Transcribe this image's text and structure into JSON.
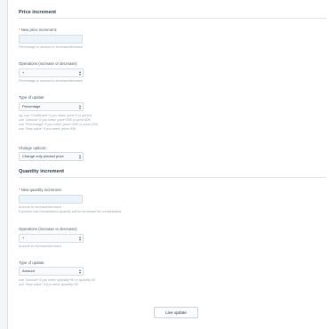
{
  "price_section": {
    "title": "Price increment",
    "new_price_label": "New price increment:",
    "new_price_value": "",
    "new_price_help": "Percentage or amount to increase/decrease",
    "operations_label": "Operations (increase or decrease):",
    "operations_value": "+",
    "operations_help": "Percentage or amount to increase/decrease",
    "type_label": "Type of update:",
    "type_value": "Percentage",
    "type_help": [
      "eg. use \"Coefficient\" if you need: price*2 or price/4",
      "use \"Amount\" if you need: price+50€ or price-50€",
      "use \"Percentage\" if you need: price+20% or price-20%",
      "use \"New value\" if you need: price=50€"
    ],
    "change_label": "Change options:",
    "change_value": "Change only product price"
  },
  "quantity_section": {
    "title": "Quantity increment",
    "new_qty_label": "New quantity increment:",
    "new_qty_value": "",
    "new_qty_help": [
      "Amount to increase/decrease",
      "If product has combinations quantity will be increased for combinations"
    ],
    "operations_label": "Operations (increase or decrease):",
    "operations_value": "+",
    "operations_help": "Amount to increase/decrease",
    "type_label": "Type of update:",
    "type_value": "Amount",
    "type_help": [
      "use \"Amount\" if you need: quantity+50 or quantity-50",
      "use \"New value\" if you need: quantity=50"
    ]
  },
  "actions": {
    "live_update_label": "Live update"
  },
  "colors": {
    "required": "#e0484b",
    "input_bg": "#eaf4fa",
    "text": "#2b3a44"
  }
}
